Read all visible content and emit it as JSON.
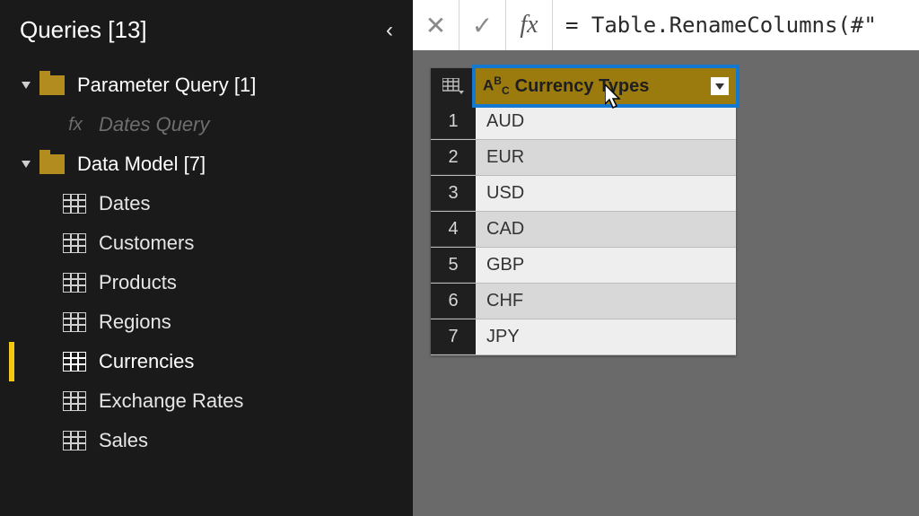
{
  "sidebar": {
    "title": "Queries [13]",
    "folders": [
      {
        "label": "Parameter Query [1]",
        "items": [
          {
            "label": "Dates Query",
            "kind": "fx"
          }
        ]
      },
      {
        "label": "Data Model [7]",
        "items": [
          {
            "label": "Dates",
            "kind": "table"
          },
          {
            "label": "Customers",
            "kind": "table"
          },
          {
            "label": "Products",
            "kind": "table"
          },
          {
            "label": "Regions",
            "kind": "table"
          },
          {
            "label": "Currencies",
            "kind": "table",
            "selected": true
          },
          {
            "label": "Exchange Rates",
            "kind": "table"
          },
          {
            "label": "Sales",
            "kind": "table"
          }
        ]
      }
    ]
  },
  "formula_bar": {
    "value": "= Table.RenameColumns(#\""
  },
  "grid": {
    "column_header": "Currency Types",
    "rows": [
      "AUD",
      "EUR",
      "USD",
      "CAD",
      "GBP",
      "CHF",
      "JPY"
    ]
  }
}
